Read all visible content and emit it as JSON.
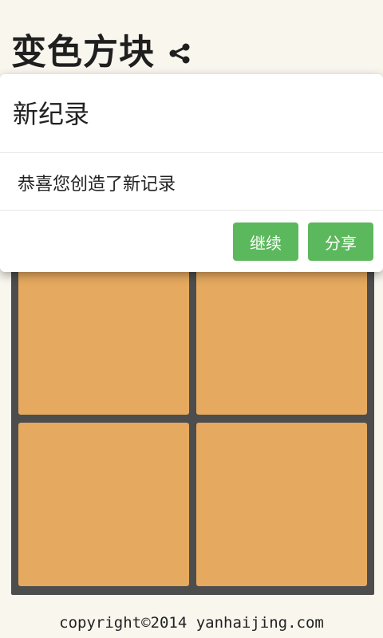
{
  "header": {
    "title": "变色方块",
    "share_icon": "share-icon"
  },
  "modal": {
    "title": "新纪录",
    "message": "恭喜您创造了新记录",
    "buttons": [
      {
        "label": "继续"
      },
      {
        "label": "分享"
      }
    ]
  },
  "board": {
    "rows": 2,
    "cols": 2,
    "tile_color": "#e5a95f",
    "grid_color": "#4d4d4d"
  },
  "footer": {
    "copyright": "copyright©2014 yanhaijing.com"
  },
  "colors": {
    "background": "#f9f6ee",
    "button": "#5cb85c"
  }
}
